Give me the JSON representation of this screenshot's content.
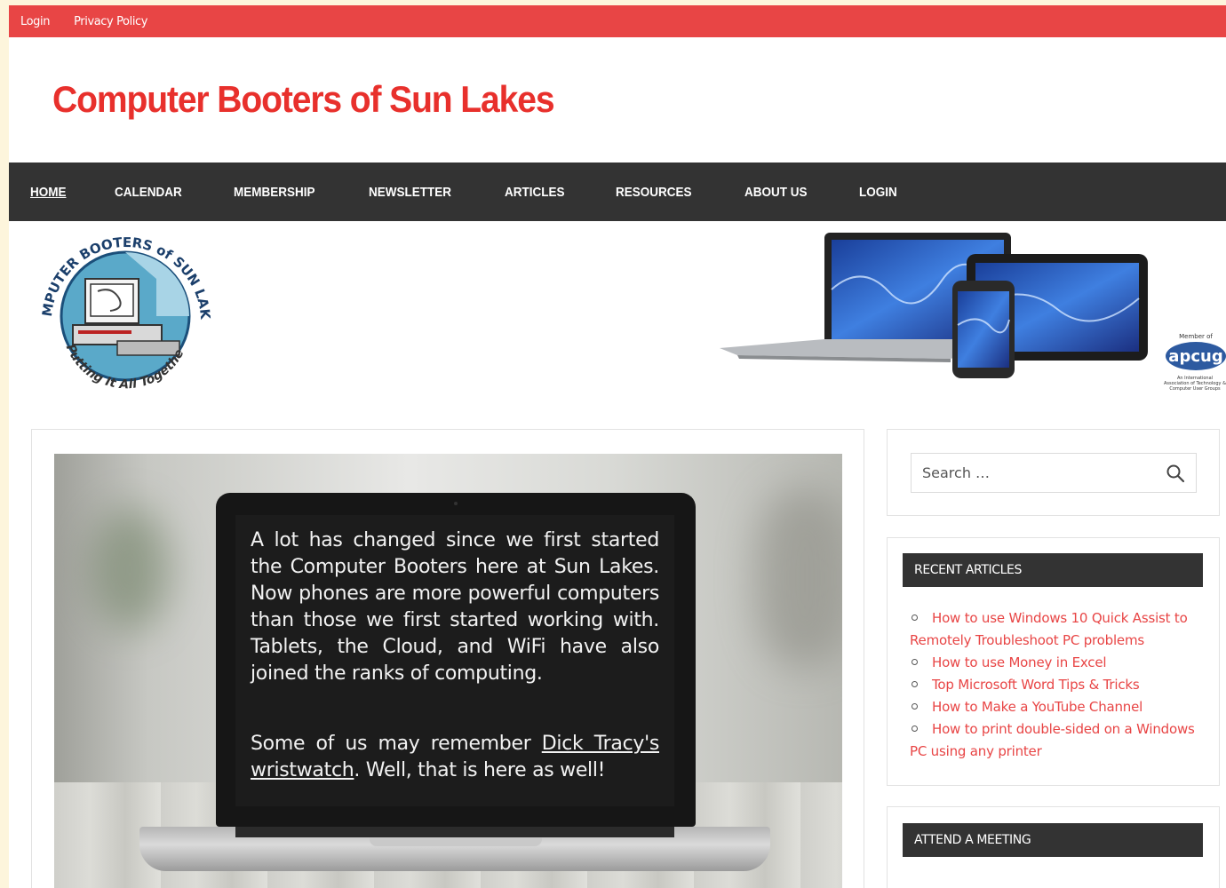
{
  "topbar": {
    "links": [
      "Login",
      "Privacy Policy"
    ]
  },
  "header": {
    "site_title": "Computer Booters of Sun Lakes"
  },
  "nav": {
    "items": [
      "HOME",
      "CALENDAR",
      "MEMBERSHIP",
      "NEWSLETTER",
      "ARTICLES",
      "RESOURCES",
      "ABOUT US",
      "LOGIN"
    ],
    "active": "HOME"
  },
  "logo": {
    "top_text": "COMPUTER BOOTERS of SUN LAKES",
    "bottom_text": "\"Putting It All Together\""
  },
  "apcug": {
    "top_text": "Member of",
    "name": "apcug",
    "sub_text": "An International Association of Technology & Computer User Groups"
  },
  "hero": {
    "paragraph1": "A lot has changed since we first started the Computer Booters here at Sun Lakes. Now phones are more powerful computers than those we first started working with. Tablets, the Cloud, and WiFi have also joined the ranks of computing.",
    "paragraph2_prefix": "Some of us may remember ",
    "paragraph2_link": "Dick Tracy's wristwatch",
    "paragraph2_suffix": ". Well, that is here as well!"
  },
  "search": {
    "placeholder": "Search …"
  },
  "recent_articles": {
    "title": "RECENT ARTICLES",
    "items": [
      "How to use Windows 10 Quick Assist to Remotely Troubleshoot PC problems",
      "How to use Money in Excel",
      "Top Microsoft Word Tips & Tricks",
      "How to Make a YouTube Channel",
      "How to print double-sided on a Windows PC using any printer"
    ]
  },
  "attend_meeting": {
    "title": "ATTEND A MEETING"
  },
  "colors": {
    "accent_red": "#e84545",
    "title_red": "#e8302c",
    "nav_dark": "#333333",
    "page_background": "#fdf5dc"
  }
}
